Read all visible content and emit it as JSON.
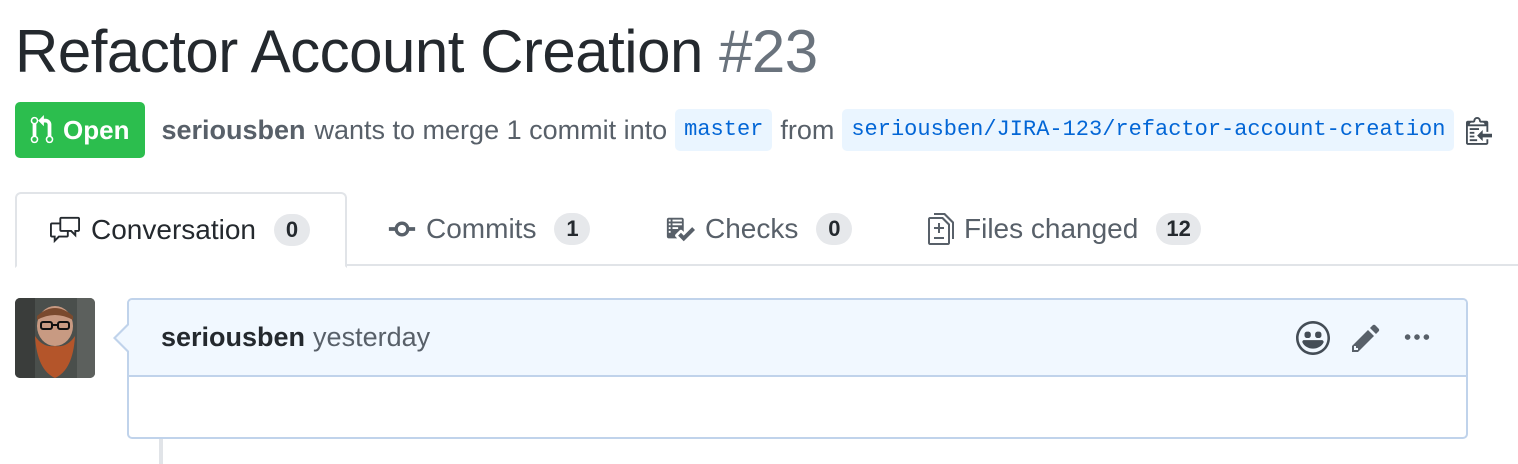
{
  "title": {
    "text": "Refactor Account Creation",
    "number": "#23"
  },
  "state": {
    "label": "Open",
    "icon": "git-pull-request-icon",
    "color": "#2cbe4e"
  },
  "meta": {
    "author": "seriousben",
    "text_before_base": "wants to merge 1 commit into",
    "base_branch": "master",
    "text_before_head": "from",
    "head_branch": "seriousben/JIRA-123/refactor-account-creation",
    "copy_icon": "clipboard-icon"
  },
  "tabs": [
    {
      "label": "Conversation",
      "count": "0",
      "icon": "comment-discussion-icon",
      "selected": true
    },
    {
      "label": "Commits",
      "count": "1",
      "icon": "git-commit-icon",
      "selected": false
    },
    {
      "label": "Checks",
      "count": "0",
      "icon": "checklist-icon",
      "selected": false
    },
    {
      "label": "Files changed",
      "count": "12",
      "icon": "diff-icon",
      "selected": false
    }
  ],
  "comment": {
    "author": "seriousben",
    "time": "yesterday",
    "actions": [
      "smiley-icon",
      "pencil-icon",
      "kebab-horizontal-icon"
    ]
  },
  "colors": {
    "link": "#0366d6",
    "branch_bg": "#eaf5ff",
    "header_bg": "#f1f8ff",
    "border": "#c0d3eb"
  }
}
